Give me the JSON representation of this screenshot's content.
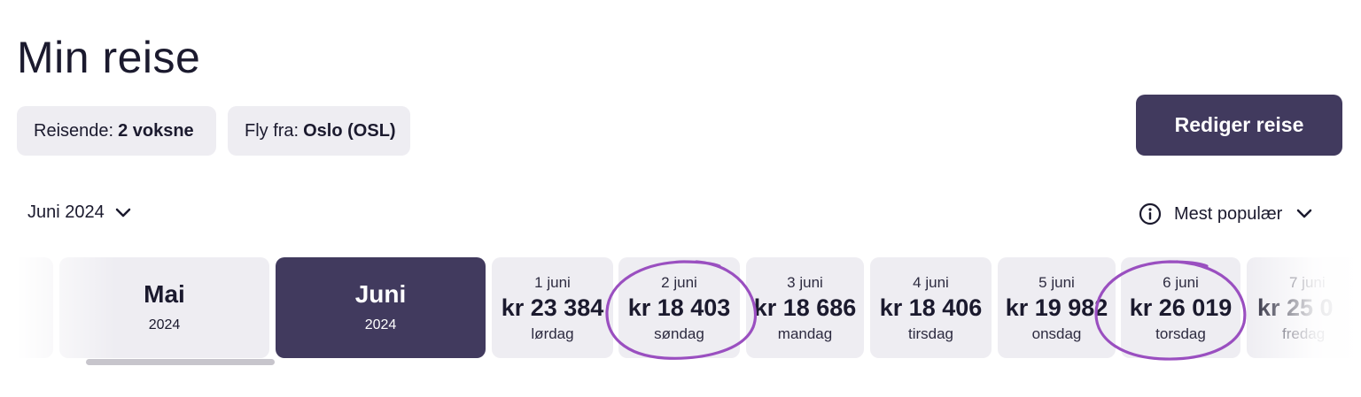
{
  "page": {
    "title": "Min reise"
  },
  "filters": {
    "travelers": {
      "label": "Reisende:",
      "value": "2 voksne"
    },
    "from": {
      "label": "Fly fra:",
      "value": "Oslo (OSL)"
    }
  },
  "actions": {
    "edit_label": "Rediger reise"
  },
  "month_selector": {
    "value": "Juni 2024"
  },
  "sort": {
    "value": "Mest populær"
  },
  "months": [
    {
      "name": "Mai",
      "year": "2024",
      "selected": false
    },
    {
      "name": "Juni",
      "year": "2024",
      "selected": true
    }
  ],
  "days": [
    {
      "date": "1 juni",
      "price": "kr 23 384",
      "weekday": "lørdag",
      "highlighted": false
    },
    {
      "date": "2 juni",
      "price": "kr 18 403",
      "weekday": "søndag",
      "highlighted": true
    },
    {
      "date": "3 juni",
      "price": "kr 18 686",
      "weekday": "mandag",
      "highlighted": false
    },
    {
      "date": "4 juni",
      "price": "kr 18 406",
      "weekday": "tirsdag",
      "highlighted": false
    },
    {
      "date": "5 juni",
      "price": "kr 19 982",
      "weekday": "onsdag",
      "highlighted": false
    },
    {
      "date": "6 juni",
      "price": "kr 26 019",
      "weekday": "torsdag",
      "highlighted": true
    },
    {
      "date": "7 juni",
      "price": "kr 25 0",
      "weekday": "fredag",
      "highlighted": false
    }
  ],
  "colors": {
    "accent": "#413a5e",
    "card_bg": "#eeedf2",
    "annotation": "#9a4fc0"
  }
}
